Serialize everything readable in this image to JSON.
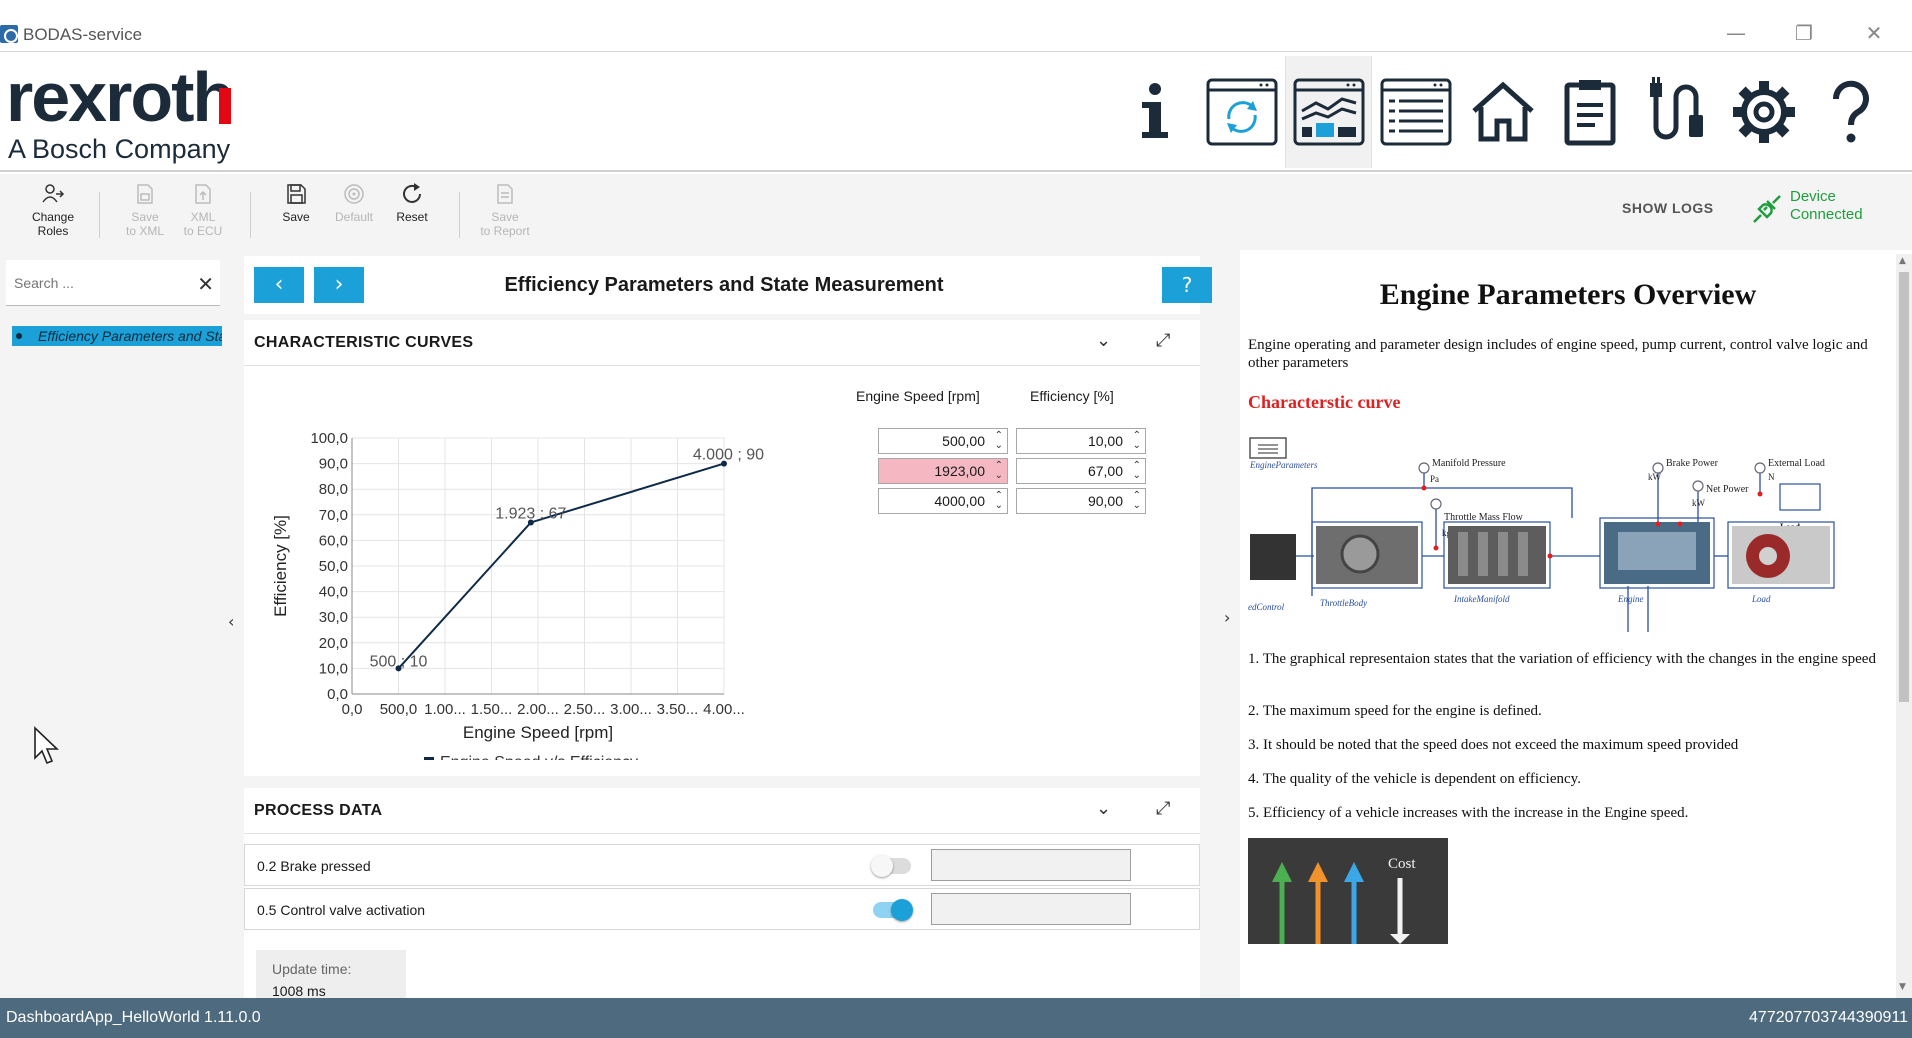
{
  "window": {
    "title": "BODAS-service",
    "minimize": "—",
    "restore": "❐",
    "close": "✕"
  },
  "brand": {
    "logo": "rexroth",
    "sub": "A Bosch Company"
  },
  "nav": [
    "info-icon",
    "refresh-window-icon",
    "dashboard-icon",
    "list-icon",
    "home-icon",
    "clipboard-icon",
    "connector-icon",
    "settings-icon",
    "help-icon"
  ],
  "toolbar": {
    "change_roles": [
      "Change",
      "Roles"
    ],
    "save_xml": [
      "Save",
      "to XML"
    ],
    "xml_ecu": [
      "XML",
      "to ECU"
    ],
    "save": "Save",
    "default": "Default",
    "reset": "Reset",
    "save_report": [
      "Save",
      "to Report"
    ],
    "show_logs": "SHOW LOGS",
    "device_status": [
      "Device",
      "Connected"
    ]
  },
  "sidebar": {
    "search_placeholder": "Search ...",
    "clear": "✕",
    "items": [
      {
        "label": "Efficiency Parameters and State Measurement"
      }
    ]
  },
  "center": {
    "prev": "‹",
    "next": "›",
    "title": "Efficiency Parameters and State Measurement",
    "help": "?",
    "curves_title": "CHARACTERISTIC CURVES",
    "process_title": "PROCESS DATA",
    "table_headers": [
      "Engine Speed [rpm]",
      "Efficiency [%]"
    ],
    "table_rows": [
      {
        "speed": "500,00",
        "eff": "10,00",
        "invalid": false
      },
      {
        "speed": "1923,00",
        "eff": "67,00",
        "invalid": true
      },
      {
        "speed": "4000,00",
        "eff": "90,00",
        "invalid": false
      }
    ],
    "process_rows": [
      {
        "label": "0.2 Brake pressed",
        "on": false
      },
      {
        "label": "0.5 Control valve activation",
        "on": true
      }
    ],
    "update_label": "Update time:",
    "update_value": "1008 ms"
  },
  "chart_data": {
    "type": "line",
    "x": [
      500,
      1923,
      4000
    ],
    "y": [
      10,
      67,
      90
    ],
    "point_labels": [
      "500 ; 10",
      "1.923 ; 67",
      "4.000 ; 90"
    ],
    "xlabel": "Engine Speed [rpm]",
    "ylabel": "Efficiency [%]",
    "xlim": [
      0,
      4000
    ],
    "ylim": [
      0,
      100
    ],
    "x_ticks": [
      "0,0",
      "500,0",
      "1.00...",
      "1.50...",
      "2.00...",
      "2.50...",
      "3.00...",
      "3.50...",
      "4.00..."
    ],
    "y_ticks": [
      "0,0",
      "10,0",
      "20,0",
      "30,0",
      "40,0",
      "50,0",
      "60,0",
      "70,0",
      "80,0",
      "90,0",
      "100,0"
    ],
    "legend": "Engine Speed v/s Efficiency",
    "grid": true,
    "color": "#0e2a47"
  },
  "doc": {
    "title": "Engine Parameters Overview",
    "intro": "Engine operating and parameter design includes of engine speed, pump current, control valve logic and other parameters",
    "subtitle": "Characterstic curve",
    "diagram_labels": [
      "EngineParameters",
      "Manifold Pressure",
      "Pa",
      "Throttle Mass Flow",
      "kg/s",
      "Brake Power",
      "kW",
      "Net Power",
      "kW",
      "External Load",
      "N",
      "Load",
      "ThrottleBody",
      "IntakeManifold",
      "Engine",
      "Load",
      "edControl"
    ],
    "points": [
      "1. The graphical representaion states that the variation of efficiency with the changes in the engine speed",
      "2. The maximum speed for the engine is defined.",
      "3. It should be noted that the speed does not exceed the maximum speed provided",
      "4. The quality of the vehicle is dependent on efficiency.",
      "5. Efficiency of a vehicle increases with the increase in the Engine speed."
    ],
    "cost_label": "Cost"
  },
  "status": {
    "left": "DashboardApp_HelloWorld 1.11.0.0",
    "right": "477207703744390911"
  }
}
